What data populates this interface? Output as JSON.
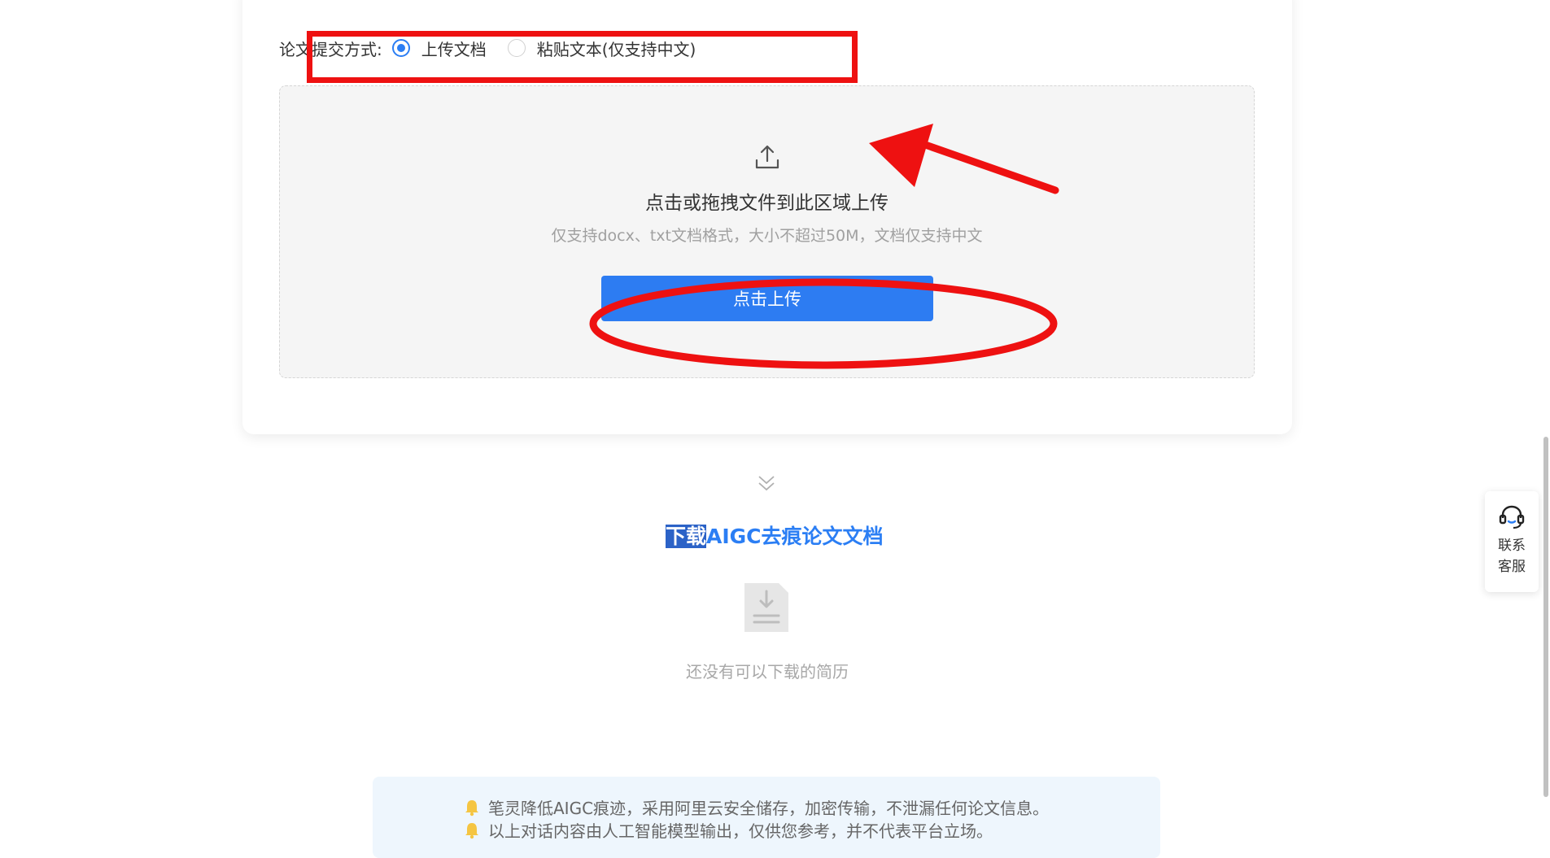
{
  "submit_mode": {
    "label": "论文提交方式:",
    "options": [
      {
        "label": "上传文档",
        "checked": true
      },
      {
        "label": "粘贴文本(仅支持中文)",
        "checked": false
      }
    ]
  },
  "upload": {
    "icon": "upload-icon",
    "title": "点击或拖拽文件到此区域上传",
    "hint": "仅支持docx、txt文档格式，大小不超过50M，文档仅支持中文",
    "button_label": "点击上传"
  },
  "download": {
    "chevron_icon": "double-chevron-down-icon",
    "title_selected": "下载",
    "title_rest": "AIGC去痕论文文档",
    "empty_icon": "document-download-icon",
    "empty_text": "还没有可以下载的简历"
  },
  "notices": [
    "笔灵降低AIGC痕迹，采用阿里云安全储存，加密传输，不泄漏任何论文信息。",
    "以上对话内容由人工智能模型输出，仅供您参考，并不代表平台立场。"
  ],
  "support": {
    "icon": "headset-icon",
    "line1": "联系",
    "line2": "客服"
  },
  "colors": {
    "accent": "#2b7ef4",
    "button": "#2d7cf2",
    "annotation": "#ee1111",
    "notice_bg": "#eef6fd"
  }
}
